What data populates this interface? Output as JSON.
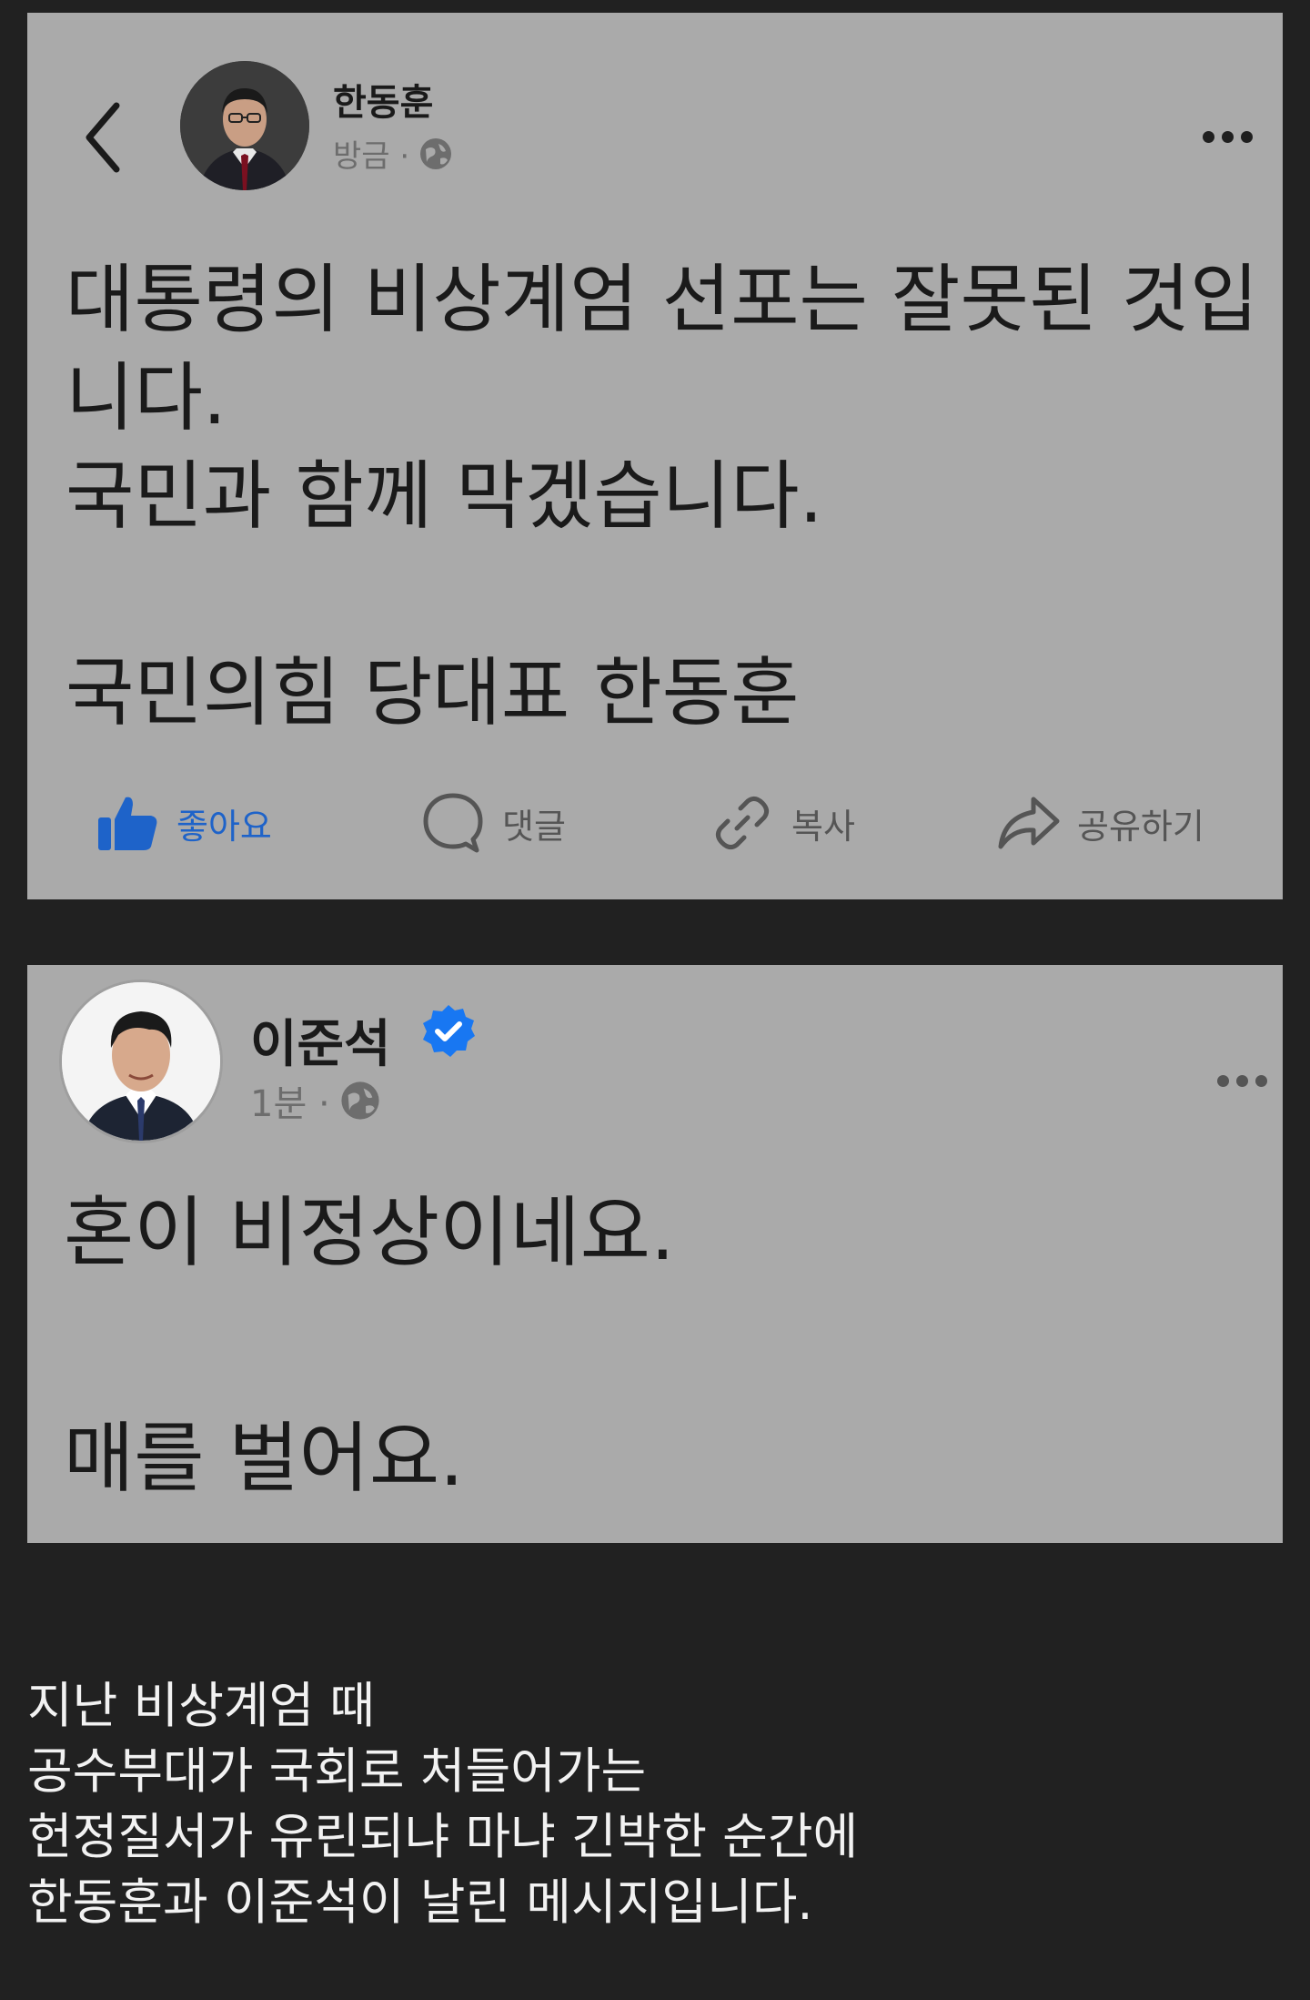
{
  "post1": {
    "author": "한동훈",
    "time": "방금 ·",
    "icons": [
      "back-icon",
      "avatar",
      "globe-icon",
      "more-icon"
    ],
    "lines": [
      "대통령의 비상계엄 선포는 잘못된 것입",
      "니다.",
      "국민과 함께 막겠습니다.",
      "",
      "국민의힘 당대표 한동훈"
    ],
    "actions": {
      "like": "좋아요",
      "comment": "댓글",
      "copy": "복사",
      "share": "공유하기"
    },
    "colors": {
      "like": "#1e63c9",
      "card": "#aaaaaa"
    }
  },
  "post2": {
    "author": "이준석",
    "time": "1분 ·",
    "icons": [
      "avatar",
      "verified-icon",
      "globe-icon",
      "more-icon"
    ],
    "lines": [
      "혼이 비정상이네요.",
      "",
      "매를 벌어요."
    ],
    "colors": {
      "verified": "#1877f2"
    }
  },
  "caption": {
    "lines": [
      "지난 비상계엄 때",
      "공수부대가 국회로 처들어가는",
      "헌정질서가 유린되냐 마냐 긴박한 순간에",
      "한동훈과 이준석이 날린 메시지입니다."
    ]
  },
  "colors": {
    "background": "#212121",
    "caption_text": "#f2f2f2"
  }
}
